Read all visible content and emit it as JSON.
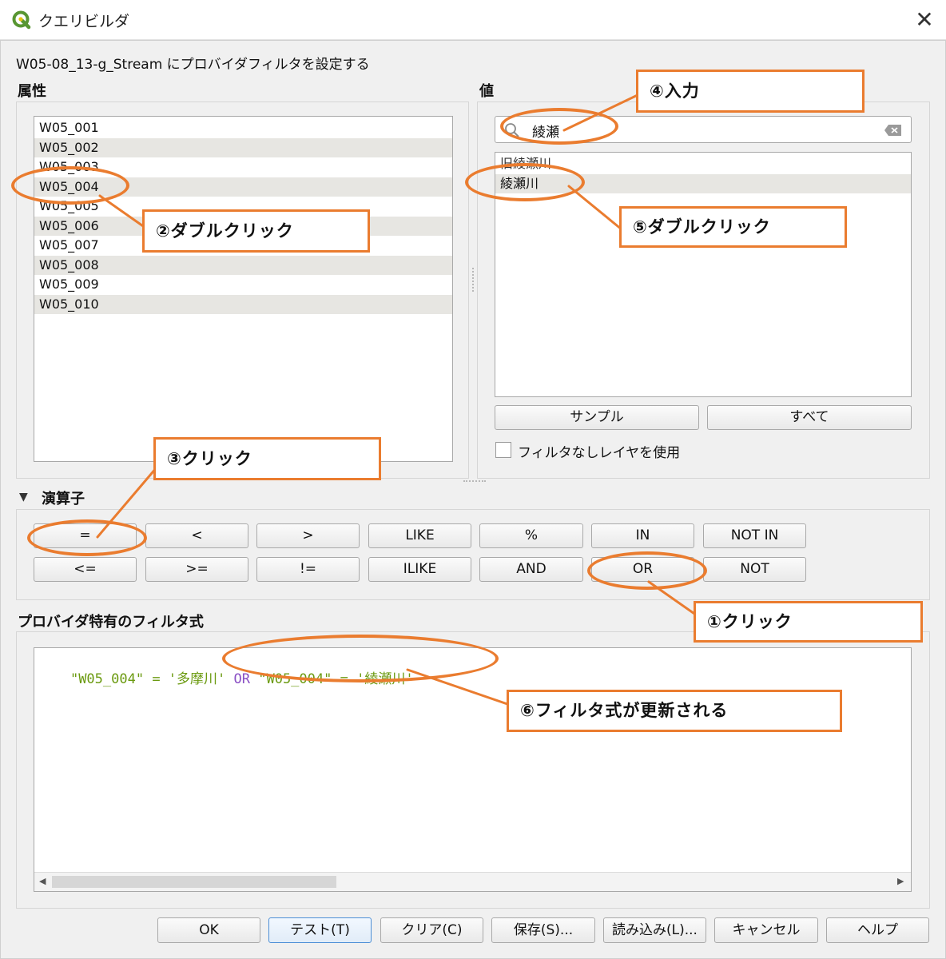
{
  "window": {
    "title": "クエリビルダ",
    "close_glyph": "✕"
  },
  "dialog": {
    "subtitle": "W05-08_13-g_Stream にプロバイダフィルタを設定する"
  },
  "fields": {
    "label": "属性",
    "items": [
      "W05_001",
      "W05_002",
      "W05_003",
      "W05_004",
      "W05_005",
      "W05_006",
      "W05_007",
      "W05_008",
      "W05_009",
      "W05_010"
    ]
  },
  "values": {
    "label": "値",
    "search_value": "綾瀬",
    "items": [
      "旧綾瀬川",
      "綾瀬川"
    ],
    "sample_button": "サンプル",
    "all_button": "すべて",
    "use_unfiltered_label": "フィルタなしレイヤを使用",
    "use_unfiltered_checked": false
  },
  "operators": {
    "label": "演算子",
    "collapse_glyph": "▼",
    "row1": [
      "=",
      "<",
      ">",
      "LIKE",
      "%",
      "IN",
      "NOT IN"
    ],
    "row2": [
      "<=",
      ">=",
      "!=",
      "ILIKE",
      "AND",
      "OR",
      "NOT"
    ]
  },
  "expression": {
    "label": "プロバイダ特有のフィルタ式",
    "tokens": [
      {
        "text": "\"W05_004\"",
        "kind": "str"
      },
      {
        "text": " = ",
        "kind": "op"
      },
      {
        "text": "'多摩川'",
        "kind": "str"
      },
      {
        "text": " OR ",
        "kind": "kw"
      },
      {
        "text": "\"W05_004\"",
        "kind": "str"
      },
      {
        "text": " = ",
        "kind": "op"
      },
      {
        "text": "'綾瀬川'",
        "kind": "str"
      }
    ]
  },
  "footer": {
    "ok": "OK",
    "test": "テスト(T)",
    "clear": "クリア(C)",
    "save": "保存(S)...",
    "load": "読み込み(L)...",
    "cancel": "キャンセル",
    "help": "ヘルプ"
  },
  "annotations": {
    "step1": "①クリック",
    "step2": "②ダブルクリック",
    "step3": "③クリック",
    "step4": "④入力",
    "step5": "⑤ダブルクリック",
    "step6": "⑥フィルタ式が更新される",
    "color": "#ea7c2f"
  },
  "colors": {
    "accent_orange": "#ea7c2f",
    "string_green": "#6b9a10",
    "keyword_purple": "#8a4fc4",
    "qgis_green": "#589632"
  }
}
